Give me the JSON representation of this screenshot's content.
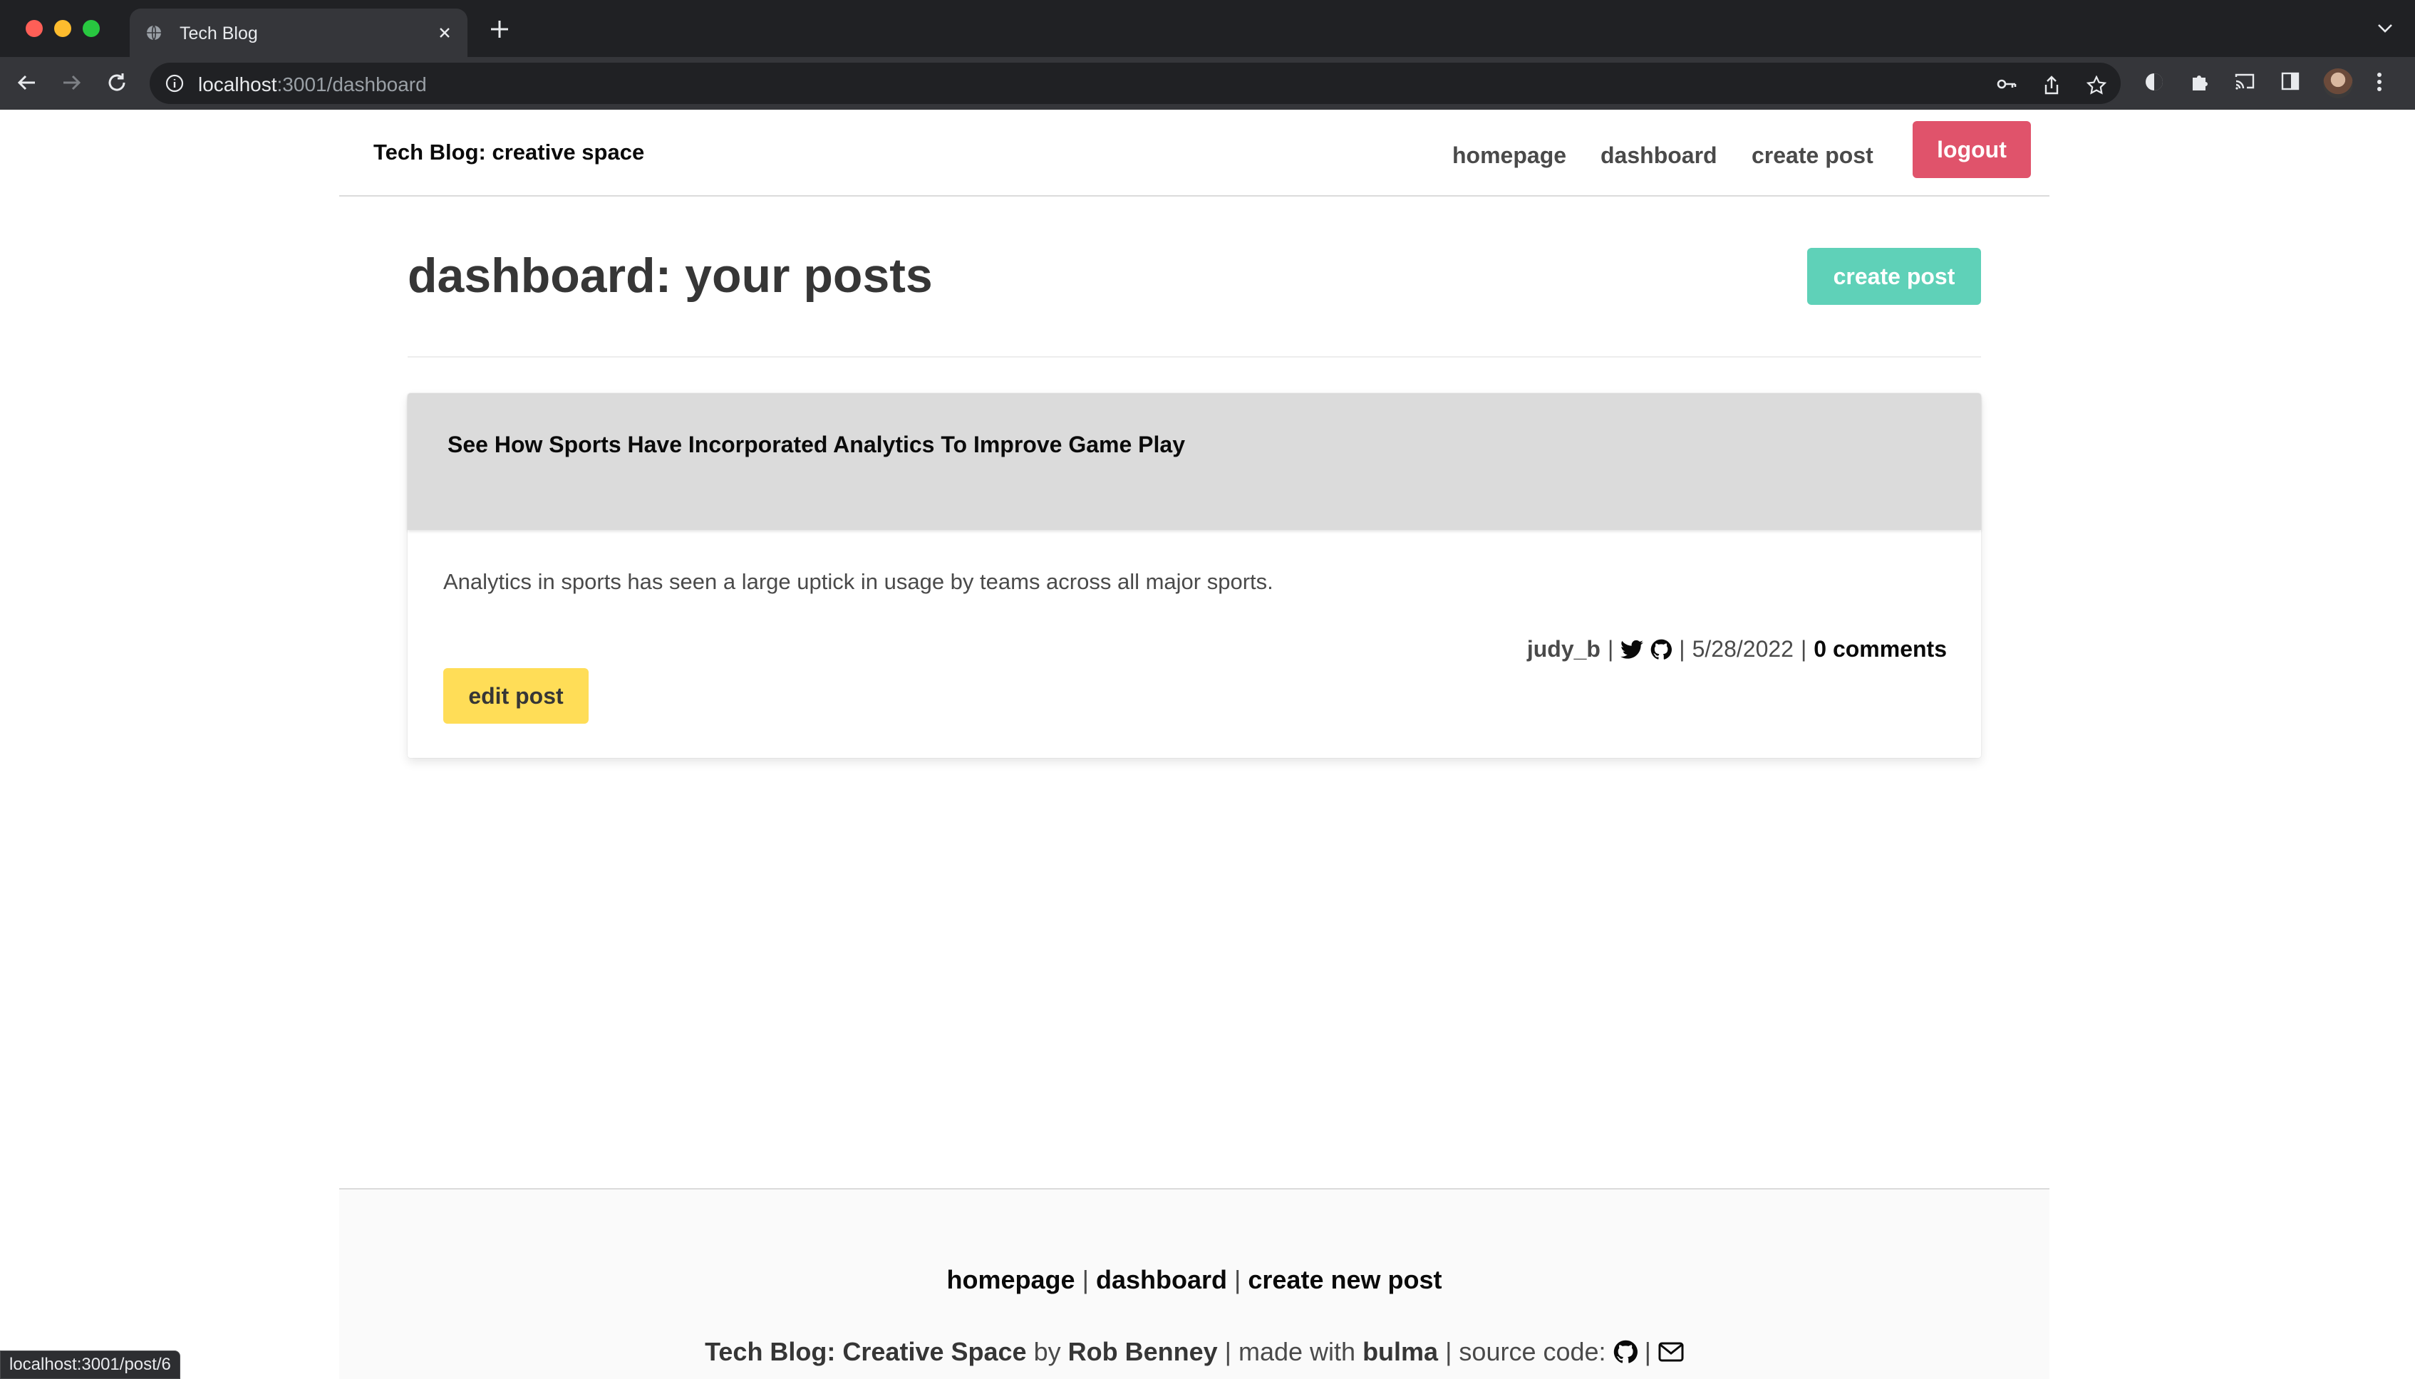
{
  "browser": {
    "tab_title": "Tech Blog",
    "url_host": "localhost",
    "url_path": ":3001/dashboard",
    "status_url": "localhost:3001/post/6"
  },
  "navbar": {
    "brand": "Tech Blog: creative space",
    "links": [
      "homepage",
      "dashboard",
      "create post"
    ],
    "logout": "logout"
  },
  "main": {
    "title": "dashboard: your posts",
    "create_post_button": "create post",
    "posts": [
      {
        "title": "See How Sports Have Incorporated Analytics To Improve Game Play",
        "excerpt": "Analytics in sports has seen a large uptick in usage by teams across all major sports.",
        "author": "judy_b",
        "date": "5/28/2022",
        "comments": "0 comments",
        "edit_button": "edit post"
      }
    ]
  },
  "footer": {
    "links": [
      "homepage",
      "dashboard",
      "create new post"
    ],
    "separator": "|",
    "site_name": "Tech Blog: Creative Space",
    "by": "by",
    "author": "Rob Benney",
    "made_with": "| made with",
    "framework": "bulma",
    "source_code": "| source code:"
  },
  "colors": {
    "logout": "#e0536b",
    "primary": "#5fd1b8",
    "warning": "#ffdd57",
    "card_header": "#dbdbdb"
  },
  "icons": {
    "social": [
      "twitter-icon",
      "github-icon"
    ],
    "footer": [
      "github-icon",
      "envelope-icon"
    ]
  }
}
